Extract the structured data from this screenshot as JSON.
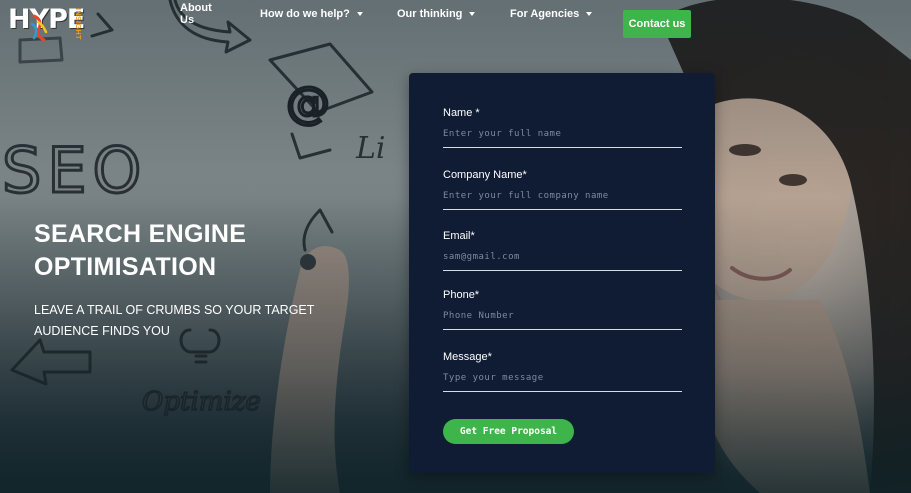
{
  "brand": {
    "logo_text": "HYPE",
    "logo_sub": "INSIGHT"
  },
  "nav": {
    "about": "About Us",
    "help": "How do we help?",
    "thinking": "Our thinking",
    "agencies": "For Agencies",
    "contact": "Contact us"
  },
  "hero": {
    "title": "SEARCH ENGINE OPTIMISATION",
    "subtitle": "LEAVE A TRAIL OF CRUMBS SO YOUR TARGET AUDIENCE FINDS YOU",
    "background_words": [
      "SEO",
      "@",
      "Li",
      "Optimize"
    ]
  },
  "form": {
    "name": {
      "label": "Name *",
      "placeholder": "Enter your full name",
      "value": ""
    },
    "company": {
      "label": "Company Name*",
      "placeholder": "Enter your full company name",
      "value": ""
    },
    "email": {
      "label": "Email*",
      "placeholder": "sam@gmail.com",
      "value": ""
    },
    "phone": {
      "label": "Phone*",
      "placeholder": "Phone Number",
      "value": ""
    },
    "message": {
      "label": "Message*",
      "placeholder": "Type your message",
      "value": ""
    },
    "submit": "Get Free Proposal"
  },
  "colors": {
    "accent_green": "#3eb54a",
    "form_bg": "#0f1c33",
    "logo_orange": "#f39a1e"
  }
}
